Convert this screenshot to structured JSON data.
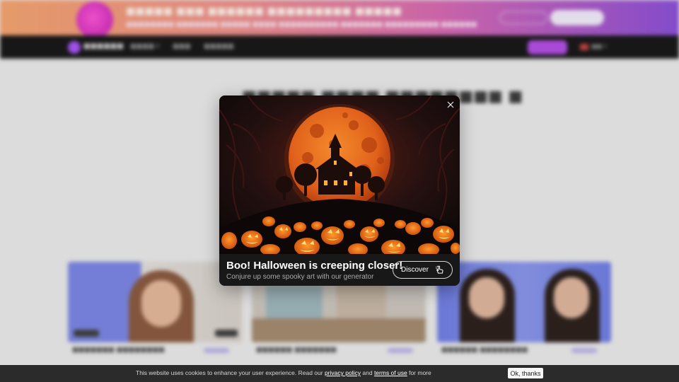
{
  "modal": {
    "title": "Boo! Halloween is creeping closer!",
    "subtitle": "Conjure up some spooky art with our generator",
    "button_label": "Discover",
    "close_icon": "close-icon",
    "button_icon": "pointer-hand-icon"
  },
  "cookie": {
    "text_before": "This website uses cookies to enhance your user experience. Read our",
    "privacy_link": "privacy policy",
    "text_and": "and",
    "terms_link": "terms of use",
    "text_after": "for more",
    "ok_label": "Ok, thanks"
  },
  "colors": {
    "promo_gradient_start": "#f6a56f",
    "promo_gradient_end": "#8c4fd8",
    "nav_background": "#161616",
    "accent_purple": "#b44ee6",
    "moon_orange": "#e0611b",
    "modal_background": "#181818",
    "cookie_bar_background": "#2b2b2b"
  }
}
